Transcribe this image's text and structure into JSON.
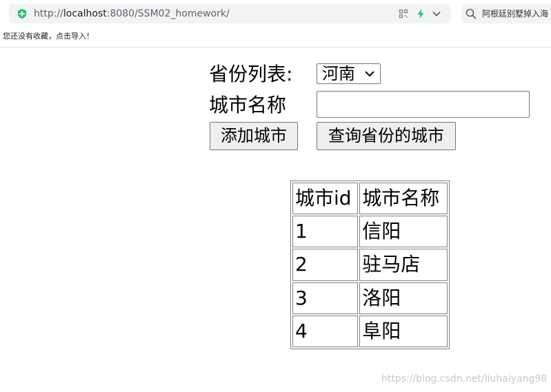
{
  "browser": {
    "url_prefix": "http://",
    "url_host": "localhost",
    "url_rest": ":8080/SSM02_homework/",
    "search_text": "阿根廷别墅掉入海",
    "bookmark_hint": "您还没有收藏，点击导入！",
    "accent_color": "#1dc466"
  },
  "form": {
    "province_label": "省份列表:",
    "province_selected": "河南",
    "city_label": "城市名称",
    "city_value": "",
    "add_button": "添加城市",
    "query_button": "查询省份的城市"
  },
  "table": {
    "headers": [
      "城市id",
      "城市名称"
    ],
    "rows": [
      [
        "1",
        "信阳"
      ],
      [
        "2",
        "驻马店"
      ],
      [
        "3",
        "洛阳"
      ],
      [
        "4",
        "阜阳"
      ]
    ]
  },
  "watermark": "https://blog.csdn.net/liuhaiyang98"
}
